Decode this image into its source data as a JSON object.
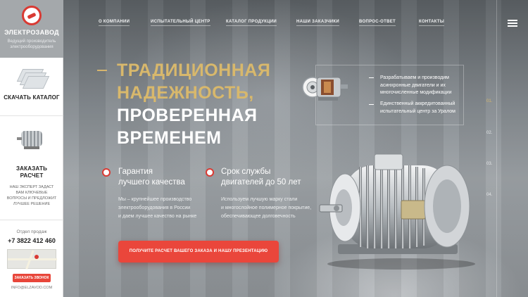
{
  "brand": {
    "title": "ЭЛЕКТРОЗАВОД",
    "subtitle": "Ведущий производитель электрооборудования"
  },
  "sidebar": {
    "catalog_label": "СКАЧАТЬ КАТАЛОГ",
    "calc_label": "ЗАКАЗАТЬ РАСЧЕТ",
    "calc_note": "НАШ ЭКСПЕРТ ЗАДАСТ ВАМ КЛЮЧЕВЫЕ ВОПРОСЫ И ПРЕДЛОЖИТ ЛУЧШЕЕ РЕШЕНИЕ",
    "dept": "Отдел продаж",
    "phone": "+7 3822 412 460",
    "call_button": "ЗАКАЗАТЬ ЗВОНОК",
    "email": "INFO@ELZAVOD.COM"
  },
  "nav": {
    "items": [
      "О КОМПАНИИ",
      "ИСПЫТАТЕЛЬНЫЙ ЦЕНТР",
      "КАТАЛОГ ПРОДУКЦИИ",
      "НАШИ ЗАКАЗЧИКИ",
      "ВОПРОС-ОТВЕТ",
      "КОНТАКТЫ"
    ]
  },
  "hero": {
    "line1": "ТРАДИЦИОННАЯ",
    "line2": "НАДЕЖНОСТЬ,",
    "line3": "ПРОВЕРЕННАЯ",
    "line4": "ВРЕМЕНЕМ",
    "benefit1_title1": "Гарантия",
    "benefit1_title2": "лучшего качества",
    "benefit1_text1": "Мы – крупнейшее производство",
    "benefit1_text2": "электрооборудования в России",
    "benefit1_text3": "и даем лучшее качество на рынке",
    "benefit2_title1": "Срок службы",
    "benefit2_title2": "двигателей до 50 лет",
    "benefit2_text1": "Используем лучшую марку стали",
    "benefit2_text2": "и многослойное полимерное покрытие,",
    "benefit2_text3": "обеспечивающее долговечность",
    "cta": "ПОЛУЧИТЕ РАСЧЕТ ВАШЕГО ЗАКАЗА И НАШУ ПРЕЗЕНТАЦИЮ"
  },
  "info": {
    "item1_l1": "Разрабатываем и производим",
    "item1_l2": "асинхронные двигатели и их",
    "item1_l3": "многочисленные модификации",
    "item2_l1": "Единственный аккредитованный",
    "item2_l2": "испытательный центр за Уралом"
  },
  "pages": [
    "01.",
    "02.",
    "03.",
    "04."
  ],
  "colors": {
    "accent": "#ea463b",
    "gold": "#d8b86c",
    "brand_red": "#d93a33"
  }
}
